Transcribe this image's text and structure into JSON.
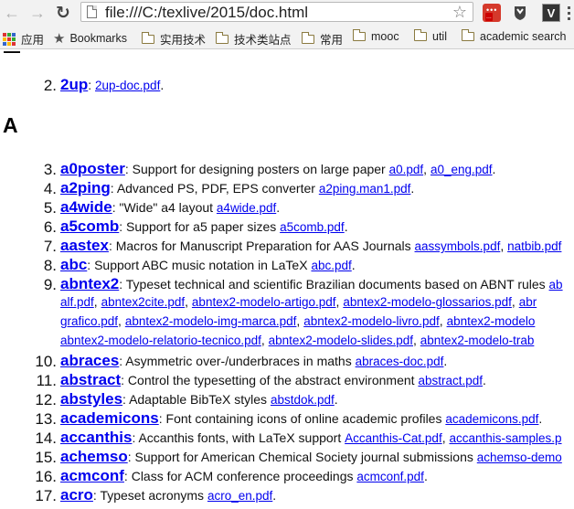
{
  "browser": {
    "url": "file:///C:/texlive/2015/doc.html",
    "badge": "..."
  },
  "bookmarks": [
    {
      "label": "应用",
      "type": "apps"
    },
    {
      "label": "Bookmarks",
      "type": "star"
    },
    {
      "label": "实用技术",
      "type": "folder"
    },
    {
      "label": "技术类站点",
      "type": "folder"
    },
    {
      "label": "常用",
      "type": "folder"
    },
    {
      "label": "mooc",
      "type": "folder"
    },
    {
      "label": "util",
      "type": "folder"
    },
    {
      "label": "academic search",
      "type": "folder"
    }
  ],
  "page": {
    "top_item": {
      "num": "2.",
      "name": "2up",
      "sep": ": ",
      "desc": "",
      "docs": [
        "2up-doc.pdf"
      ],
      "trail": "."
    },
    "section_heading": "A",
    "items": [
      {
        "num": "3.",
        "name": "a0poster",
        "desc": "Support for designing posters on large paper ",
        "docs": [
          "a0.pdf",
          "a0_eng.pdf"
        ],
        "trail": "."
      },
      {
        "num": "4.",
        "name": "a2ping",
        "desc": "Advanced PS, PDF, EPS converter ",
        "docs": [
          "a2ping.man1.pdf"
        ],
        "trail": "."
      },
      {
        "num": "5.",
        "name": "a4wide",
        "desc": "\"Wide\" a4 layout ",
        "docs": [
          "a4wide.pdf"
        ],
        "trail": "."
      },
      {
        "num": "6.",
        "name": "a5comb",
        "desc": "Support for a5 paper sizes ",
        "docs": [
          "a5comb.pdf"
        ],
        "trail": "."
      },
      {
        "num": "7.",
        "name": "aastex",
        "desc": "Macros for Manuscript Preparation for AAS Journals ",
        "docs": [
          "aassymbols.pdf",
          "natbib.pdf"
        ],
        "trail": ""
      },
      {
        "num": "8.",
        "name": "abc",
        "desc": "Support ABC music notation in LaTeX ",
        "docs": [
          "abc.pdf"
        ],
        "trail": "."
      },
      {
        "num": "9.",
        "name": "abntex2",
        "desc": "Typeset technical and scientific Brazilian documents based on ABNT rules ",
        "docs": [
          "ab"
        ],
        "trail": ""
      },
      {
        "num": "10.",
        "name": "abraces",
        "desc": "Asymmetric over-/underbraces in maths ",
        "docs": [
          "abraces-doc.pdf"
        ],
        "trail": "."
      },
      {
        "num": "11.",
        "name": "abstract",
        "desc": "Control the typesetting of the abstract environment ",
        "docs": [
          "abstract.pdf"
        ],
        "trail": "."
      },
      {
        "num": "12.",
        "name": "abstyles",
        "desc": "Adaptable BibTeX styles ",
        "docs": [
          "abstdok.pdf"
        ],
        "trail": "."
      },
      {
        "num": "13.",
        "name": "academicons",
        "desc": "Font containing icons of online academic profiles ",
        "docs": [
          "academicons.pdf"
        ],
        "trail": "."
      },
      {
        "num": "14.",
        "name": "accanthis",
        "desc": "Accanthis fonts, with LaTeX support ",
        "docs": [
          "Accanthis-Cat.pdf",
          "accanthis-samples.p"
        ],
        "trail": ""
      },
      {
        "num": "15.",
        "name": "achemso",
        "desc": "Support for American Chemical Society journal submissions ",
        "docs": [
          "achemso-demo"
        ],
        "trail": ""
      },
      {
        "num": "16.",
        "name": "acmconf",
        "desc": "Class for ACM conference proceedings ",
        "docs": [
          "acmconf.pdf"
        ],
        "trail": "."
      },
      {
        "num": "17.",
        "name": "acro",
        "desc": "Typeset acronyms ",
        "docs": [
          "acro_en.pdf"
        ],
        "trail": "."
      }
    ],
    "abntex2_continuation": [
      [
        "alf.pdf",
        "abntex2cite.pdf",
        "abntex2-modelo-artigo.pdf",
        "abntex2-modelo-glossarios.pdf",
        "abr"
      ],
      [
        "grafico.pdf",
        "abntex2-modelo-img-marca.pdf",
        "abntex2-modelo-livro.pdf",
        "abntex2-modelo"
      ],
      [
        "abntex2-modelo-relatorio-tecnico.pdf",
        "abntex2-modelo-slides.pdf",
        "abntex2-modelo-trab"
      ]
    ]
  }
}
